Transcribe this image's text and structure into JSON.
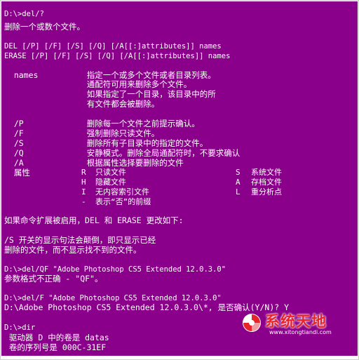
{
  "console": {
    "background": "#8b008b",
    "text_color": "#ffffff",
    "lines": {
      "l01": "D:\\>del/?",
      "l02": "删除一个或数个文件。",
      "l03": "DEL [/P] [/F] [/S] [/Q] [/A[[:]attributes]] names",
      "l04": "ERASE [/P] [/F] [/S] [/Q] [/A[[:]attributes]] names",
      "l05": "  names          指定一个或多个文件或者目录列表。",
      "l06": "                 通配符可用来删除多个文件。",
      "l07": "                 如果指定了一个目录，该目录中的所",
      "l08": "                 有文件都会被删除。",
      "l09": "  /P             删除每一个文件之前提示确认。",
      "l10": "  /F             强制删除只读文件。",
      "l11": "  /S             删除所有子目录中的指定的文件。",
      "l12": "  /Q             安静模式。删除全局通配符时，不要求确认",
      "l13": "  /A             根据属性选择要删除的文件",
      "l14": "  属性",
      "l15": "如果命令扩展被启用，DEL 和 ERASE 更改如下:",
      "l16": "/S 开关的显示句法会颠倒，即只显示已经",
      "l17": "删除的文件，而不显示找不到的文件。",
      "l18": "D:\\>del/QF \"Adobe Photoshop CS5 Extended 12.0.3.0\"",
      "l19": "参数格式不正确 - \"QF\"。",
      "l20": "D:\\>del/F \"Adobe Photoshop CS5 Extended 12.0.3.0\"",
      "l21": "D:\\Adobe Photoshop CS5 Extended 12.0.3.0\\*, 是否确认(Y/N)? Y",
      "l22": "D:\\>dir",
      "l23": " 驱动器 D 中的卷是 datas",
      "l24": " 卷的序列号是 000C-31EF"
    },
    "attributes": {
      "r_key": "R",
      "r_desc": "只读文件",
      "s_key": "S",
      "s_desc": "系统文件",
      "h_key": "H",
      "h_desc": "隐藏文件",
      "a_key": "A",
      "a_desc": "存档文件",
      "i_key": "I",
      "i_desc": "无内容索引文件",
      "l_key": "L",
      "l_desc": "重分析点",
      "dash_key": "-",
      "dash_desc": "表示“否”的前缀"
    }
  },
  "watermark": {
    "title": "系统天地",
    "url": "www.xitongtiandi.com",
    "logo_icon": "watermark-logo-icon"
  }
}
